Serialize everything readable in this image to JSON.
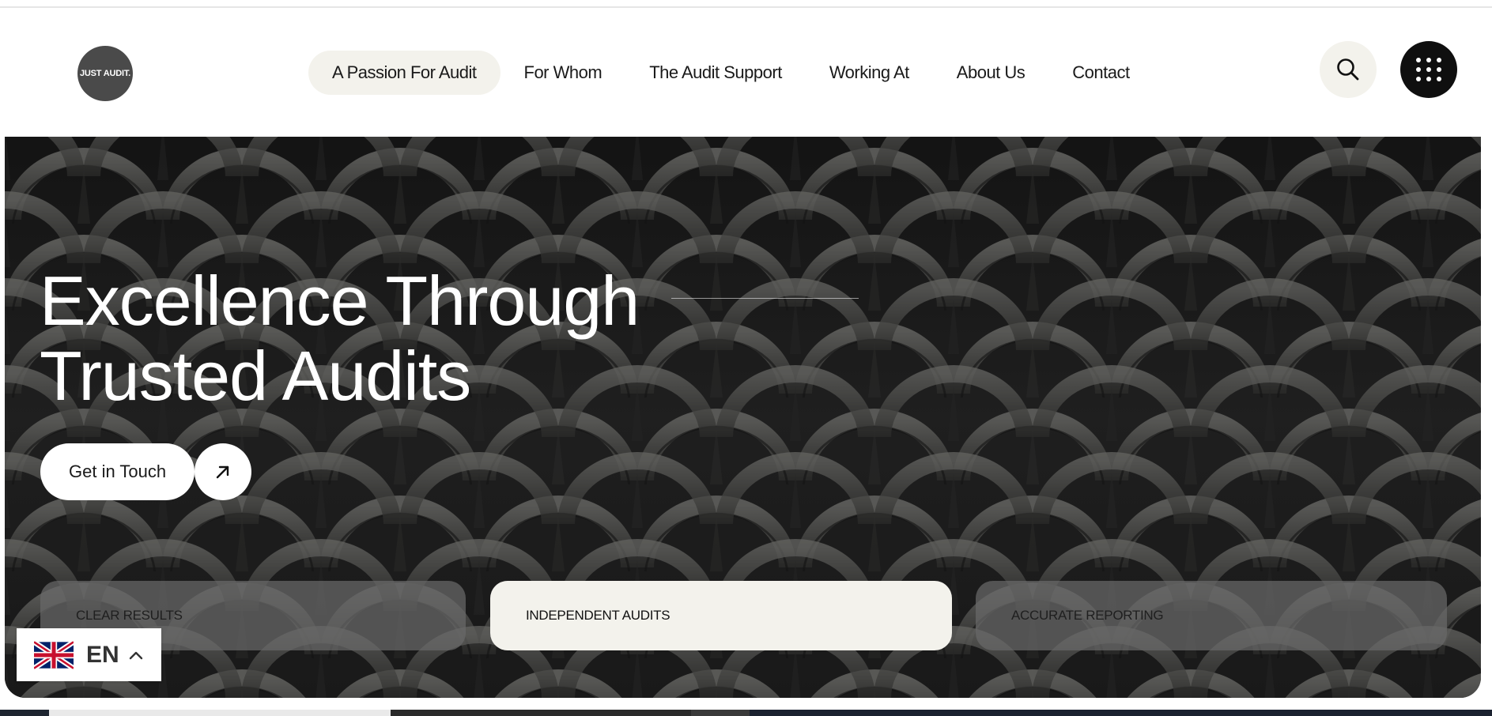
{
  "header": {
    "logo_text": "JUST AUDIT.",
    "nav": [
      {
        "label": "A Passion For Audit",
        "active": true
      },
      {
        "label": "For Whom",
        "active": false
      },
      {
        "label": "The Audit Support",
        "active": false
      },
      {
        "label": "Working At",
        "active": false
      },
      {
        "label": "About Us",
        "active": false
      },
      {
        "label": "Contact",
        "active": false
      }
    ],
    "search_icon": "search-icon",
    "menu_icon": "grid-menu-icon"
  },
  "hero": {
    "title_line1": "Excellence Through",
    "title_line2": "Trusted Audits",
    "cta_label": "Get in Touch",
    "cta_icon": "arrow-up-right-icon",
    "tabs": [
      {
        "label": "CLEAR RESULTS",
        "active": false
      },
      {
        "label": "INDEPENDENT AUDITS",
        "active": true
      },
      {
        "label": "ACCURATE REPORTING",
        "active": false
      }
    ]
  },
  "language": {
    "code": "EN",
    "flag_icon": "uk-flag-icon",
    "chevron_icon": "chevron-up-icon"
  },
  "colors": {
    "nav_active_bg": "#f3f2ec",
    "menu_button_bg": "#0f0f0f",
    "hero_bg": "#2a2a2a"
  }
}
